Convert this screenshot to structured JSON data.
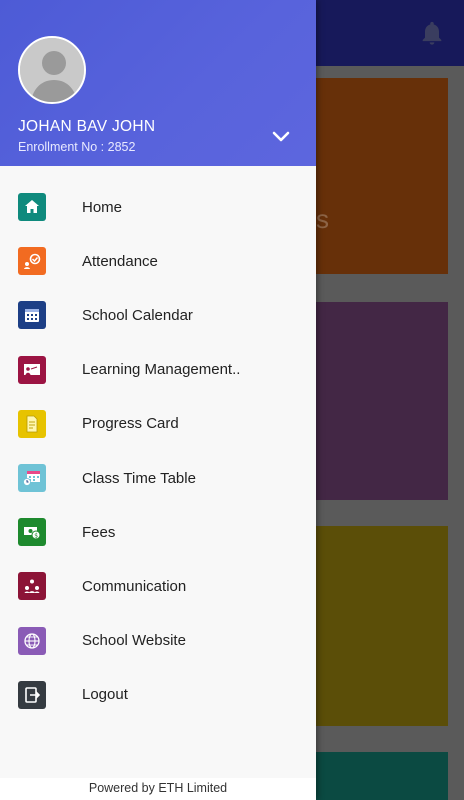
{
  "colors": {
    "toolbar": "#17195a",
    "header_gradient_start": "#4d5bd6",
    "header_gradient_end": "#5d66de",
    "card_orange": "#673009",
    "card_purple": "#432745",
    "card_yellow": "#5b4e08",
    "card_teal": "#0b4a42"
  },
  "background": {
    "notification_icon": "bell-icon",
    "ghost_text": "s"
  },
  "drawer": {
    "user": {
      "name": "JOHAN BAV JOHN",
      "enrollment": "Enrollment No : 2852"
    },
    "menu": [
      {
        "label": "Home",
        "icon": "home-icon",
        "color": "#0f8a7d"
      },
      {
        "label": "Attendance",
        "icon": "attendance-icon",
        "color": "#f26b21"
      },
      {
        "label": "School Calendar",
        "icon": "calendar-icon",
        "color": "#1d3f86"
      },
      {
        "label": "Learning Management..",
        "icon": "learning-icon",
        "color": "#9c1443"
      },
      {
        "label": "Progress Card",
        "icon": "progress-card-icon",
        "color": "#e7c300"
      },
      {
        "label": "Class Time Table",
        "icon": "timetable-icon",
        "color": "#6fc3d6"
      },
      {
        "label": "Fees",
        "icon": "fees-icon",
        "color": "#1e8a2e"
      },
      {
        "label": "Communication",
        "icon": "communication-icon",
        "color": "#8c1437"
      },
      {
        "label": "School Website",
        "icon": "globe-icon",
        "color": "#8a5bb6"
      },
      {
        "label": "Logout",
        "icon": "logout-icon",
        "color": "#353b41"
      }
    ],
    "footer": "Powered by ETH Limited"
  }
}
